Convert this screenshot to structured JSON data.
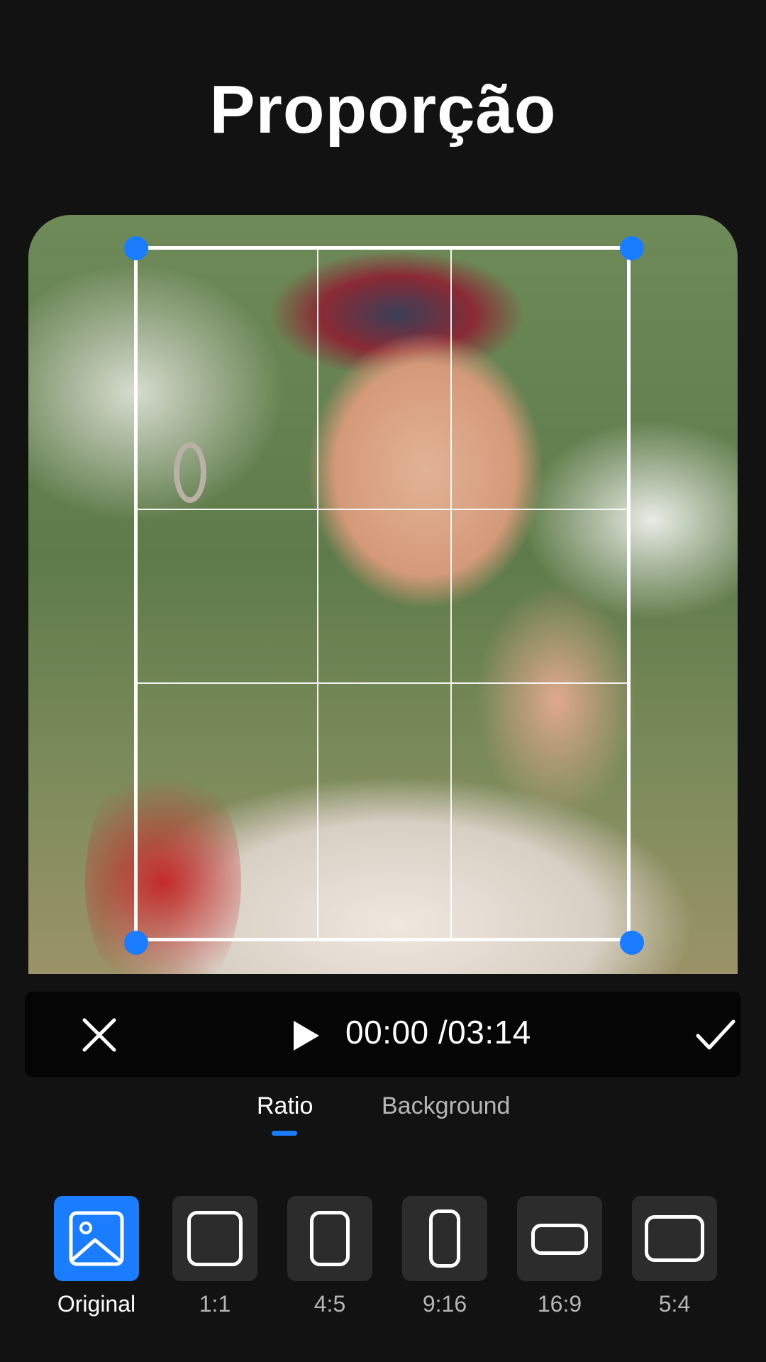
{
  "header": {
    "title": "Proporção"
  },
  "player": {
    "current_time": "00:00",
    "total_time": "/03:14",
    "icons": {
      "close": "close-icon",
      "play": "play-icon",
      "confirm": "checkmark-icon"
    }
  },
  "tabs": [
    {
      "label": "Ratio",
      "active": true
    },
    {
      "label": "Background",
      "active": false
    }
  ],
  "ratio_options": [
    {
      "label": "Original",
      "selected": true,
      "icon": "image-icon"
    },
    {
      "label": "1:1",
      "selected": false,
      "icon": "square-frame-icon"
    },
    {
      "label": "4:5",
      "selected": false,
      "icon": "portrait-frame-icon"
    },
    {
      "label": "9:16",
      "selected": false,
      "icon": "tall-portrait-frame-icon"
    },
    {
      "label": "16:9",
      "selected": false,
      "icon": "wide-frame-icon"
    },
    {
      "label": "5:4",
      "selected": false,
      "icon": "landscape-frame-icon"
    }
  ],
  "colors": {
    "accent": "#1a7cff",
    "background": "#121212",
    "player_bar": "#050505"
  }
}
